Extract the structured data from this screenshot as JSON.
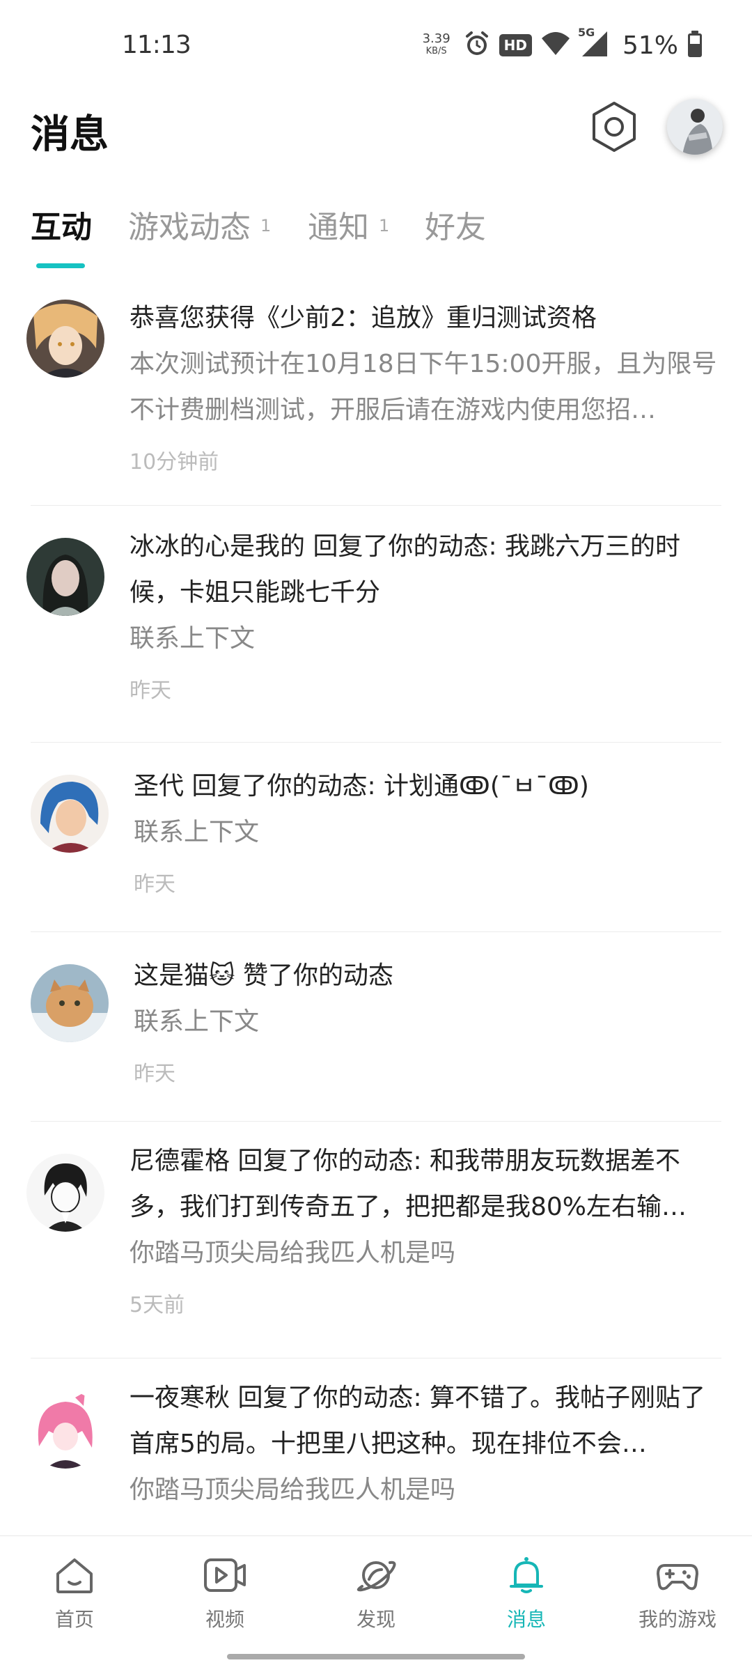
{
  "status_bar": {
    "time": "11:13",
    "net_speed": "3.39",
    "net_unit": "KB/S",
    "hd": "HD",
    "network": "5G",
    "battery": "51%"
  },
  "header": {
    "title": "消息"
  },
  "tabs": [
    {
      "label": "互动",
      "count": ""
    },
    {
      "label": "游戏动态",
      "count": "1"
    },
    {
      "label": "通知",
      "count": "1"
    },
    {
      "label": "好友",
      "count": ""
    }
  ],
  "messages": [
    {
      "title": "恭喜您获得《少前2：追放》重归测试资格",
      "content": "本次测试预计在10月18日下午15:00开服，且为限号不计费删档测试，开服后请在游戏内使用您招…",
      "time": "10分钟前"
    },
    {
      "title": "冰冰的心是我的 回复了你的动态: 我跳六万三的时候，卡姐只能跳七千分",
      "content": "联系上下文",
      "time": "昨天"
    },
    {
      "title": "圣代 回复了你的动态: 计划通ↂ(¯ㅂ¯ↂ)",
      "content": "联系上下文",
      "time": "昨天"
    },
    {
      "title": "这是猫🐱 赞了你的动态",
      "content": "联系上下文",
      "time": "昨天"
    },
    {
      "title": "尼德霍格 回复了你的动态: 和我带朋友玩数据差不多，我们打到传奇五了，把把都是我80%左右输…",
      "content": "你踏马顶尖局给我匹人机是吗",
      "time": "5天前"
    },
    {
      "title": "一夜寒秋 回复了你的动态: 算不错了。我帖子刚贴了首席5的局。十把里八把这种。现在排位不会…",
      "content": "你踏马顶尖局给我匹人机是吗",
      "time": ""
    }
  ],
  "bottom_nav": [
    {
      "label": "首页",
      "icon": "home-icon"
    },
    {
      "label": "视频",
      "icon": "video-icon"
    },
    {
      "label": "发现",
      "icon": "planet-icon"
    },
    {
      "label": "消息",
      "icon": "bell-icon",
      "active": true
    },
    {
      "label": "我的游戏",
      "icon": "gamepad-icon"
    }
  ],
  "colors": {
    "accent": "#16c2c2",
    "text_primary": "#222222",
    "text_secondary": "#888888",
    "text_time": "#bbbbbb"
  }
}
